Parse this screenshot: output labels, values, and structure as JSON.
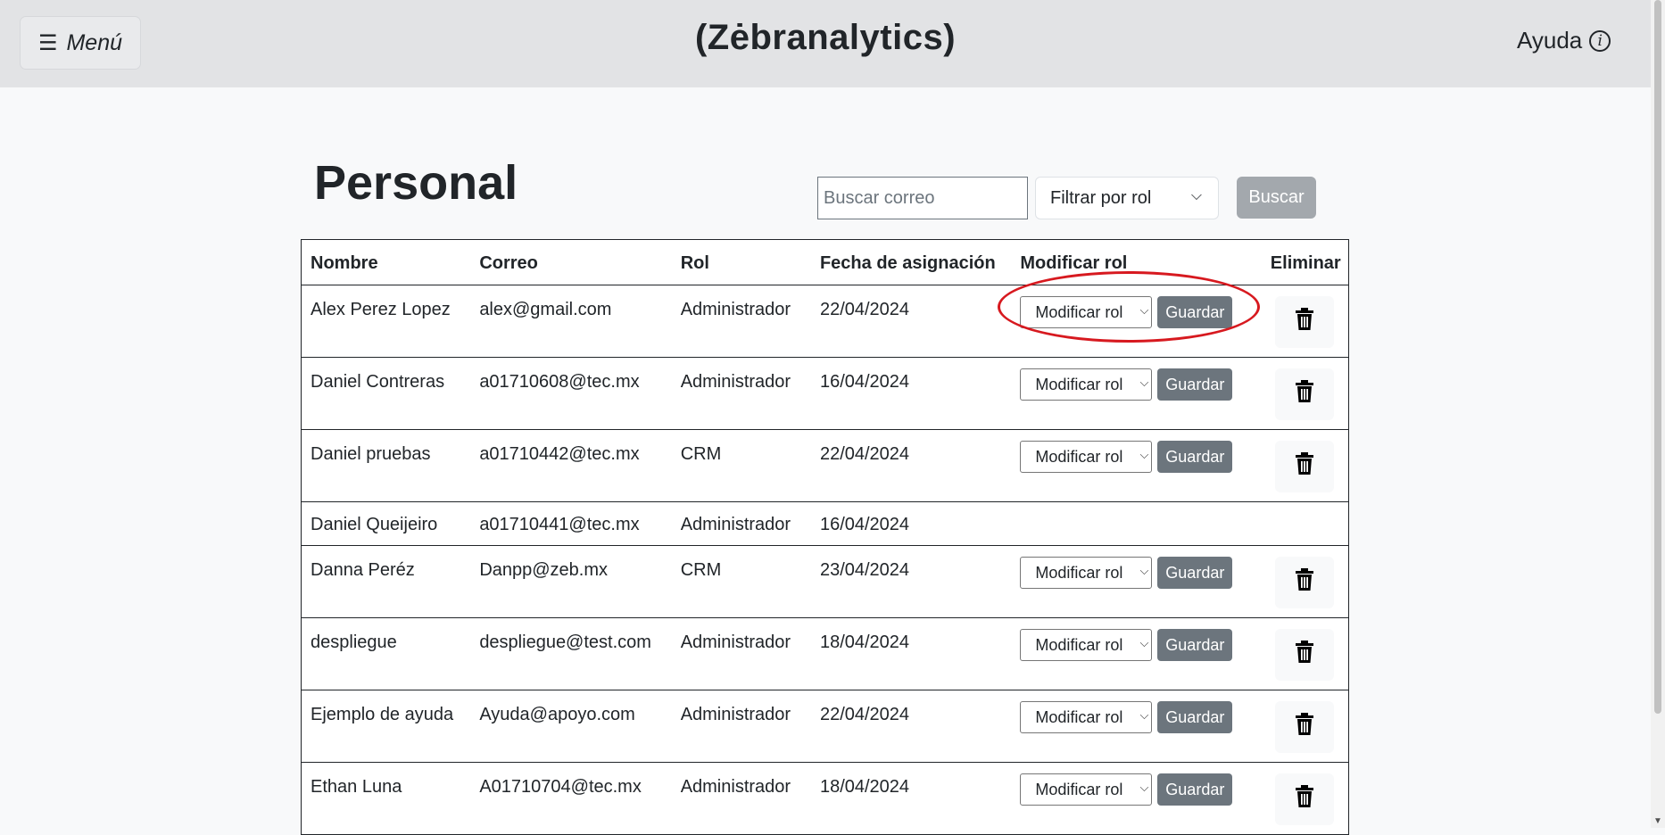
{
  "navbar": {
    "menu_label": "Menú",
    "brand": "(Zėbranalytics)",
    "help_label": "Ayuda",
    "help_glyph": "i"
  },
  "page": {
    "title": "Personal",
    "search_placeholder": "Buscar correo",
    "role_filter_label": "Filtrar por rol",
    "search_button": "Buscar"
  },
  "table": {
    "headers": [
      "Nombre",
      "Correo",
      "Rol",
      "Fecha de asignación",
      "Modificar rol",
      "Eliminar"
    ],
    "select_label": "Modificar rol",
    "save_label": "Guardar",
    "rows": [
      {
        "name": "Alex Perez Lopez",
        "email": "alex@gmail.com",
        "role": "Administrador",
        "date": "22/04/2024",
        "actions": true
      },
      {
        "name": "Daniel Contreras",
        "email": "a01710608@tec.mx",
        "role": "Administrador",
        "date": "16/04/2024",
        "actions": true
      },
      {
        "name": "Daniel pruebas",
        "email": "a01710442@tec.mx",
        "role": "CRM",
        "date": "22/04/2024",
        "actions": true
      },
      {
        "name": "Daniel Queijeiro",
        "email": "a01710441@tec.mx",
        "role": "Administrador",
        "date": "16/04/2024",
        "actions": false
      },
      {
        "name": "Danna Peréz",
        "email": "Danpp@zeb.mx",
        "role": "CRM",
        "date": "23/04/2024",
        "actions": true
      },
      {
        "name": "despliegue",
        "email": "despliegue@test.com",
        "role": "Administrador",
        "date": "18/04/2024",
        "actions": true
      },
      {
        "name": "Ejemplo de ayuda",
        "email": "Ayuda@apoyo.com",
        "role": "Administrador",
        "date": "22/04/2024",
        "actions": true
      },
      {
        "name": "Ethan Luna",
        "email": "A01710704@tec.mx",
        "role": "Administrador",
        "date": "18/04/2024",
        "actions": true
      }
    ]
  },
  "colors": {
    "navbar_bg": "#e2e3e5",
    "save_button_bg": "#6c757d",
    "search_button_bg": "#a3a8ad",
    "annotation": "#d7191f"
  }
}
